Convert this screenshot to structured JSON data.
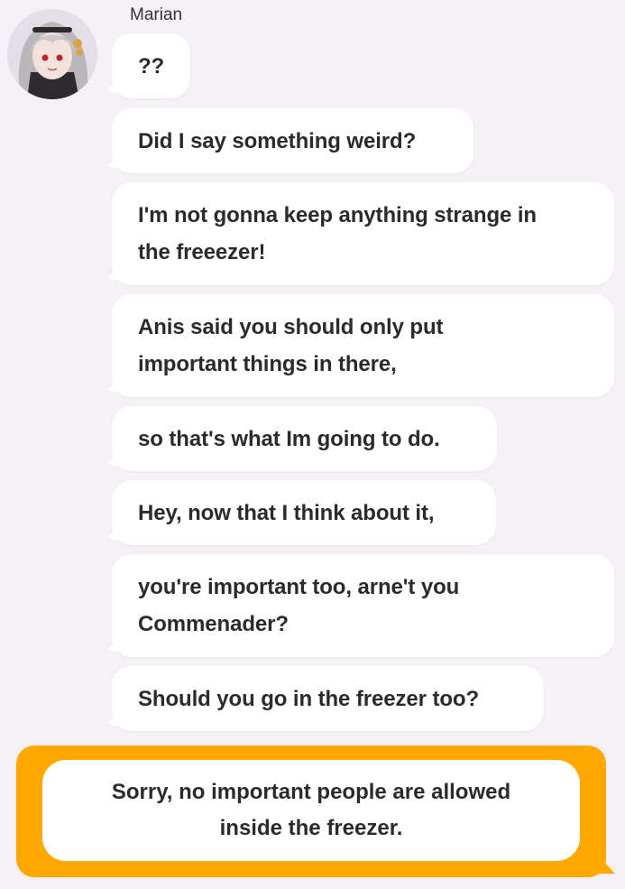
{
  "sender": {
    "name": "Marian",
    "avatar_icon": "character-portrait-icon"
  },
  "messages": [
    {
      "text": "??"
    },
    {
      "text": "Did I say something weird?"
    },
    {
      "text": "I'm not gonna keep anything strange in\nthe freeezer!"
    },
    {
      "text": "Anis said you should only put\nimportant things in there,"
    },
    {
      "text": "so that's what Im going to do."
    },
    {
      "text": "Hey, now that I think about it,"
    },
    {
      "text": "you're important too, arne't you\nCommenader?"
    },
    {
      "text": "Should you go in the freezer too?"
    }
  ],
  "reply_option": {
    "text": "Sorry, no important people are allowed\ninside the freezer."
  },
  "colors": {
    "background": "#f5f1f6",
    "bubble": "#ffffff",
    "accent": "#ffa800",
    "text": "#2b2b2b"
  }
}
